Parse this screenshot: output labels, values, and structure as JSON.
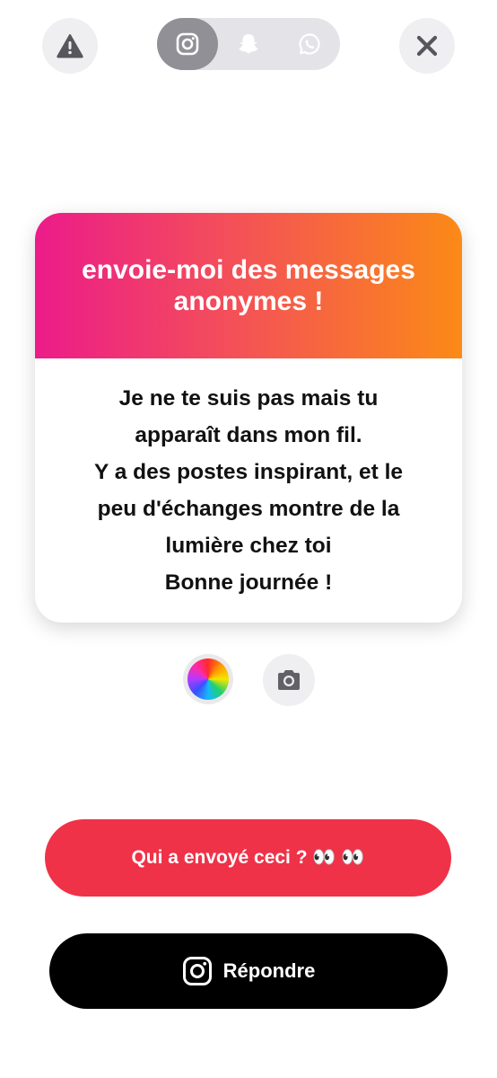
{
  "top_bar": {
    "report_icon": "warning-triangle-icon",
    "close_icon": "close-x-icon",
    "share_options": [
      {
        "icon": "instagram-icon",
        "active": true
      },
      {
        "icon": "snapchat-icon",
        "active": false
      },
      {
        "icon": "whatsapp-icon",
        "active": false
      }
    ]
  },
  "card": {
    "title": "envoie-moi des messages anonymes !",
    "message": "Je ne te suis pas mais tu\napparaît dans mon fil.\nY a des postes inspirant, et le\npeu d'échanges montre de la\nlumière chez toi\nBonne journée !",
    "gradient": [
      "#ec1b8a",
      "#fb8a16"
    ]
  },
  "tools": {
    "color_icon": "color-wheel-icon",
    "camera_icon": "camera-icon"
  },
  "buttons": {
    "who_sent": "Qui a envoyé ceci ? 👀 👀",
    "reply": "Répondre",
    "reply_icon": "instagram-icon"
  },
  "colors": {
    "accent_red": "#ef3248",
    "black": "#000000"
  }
}
